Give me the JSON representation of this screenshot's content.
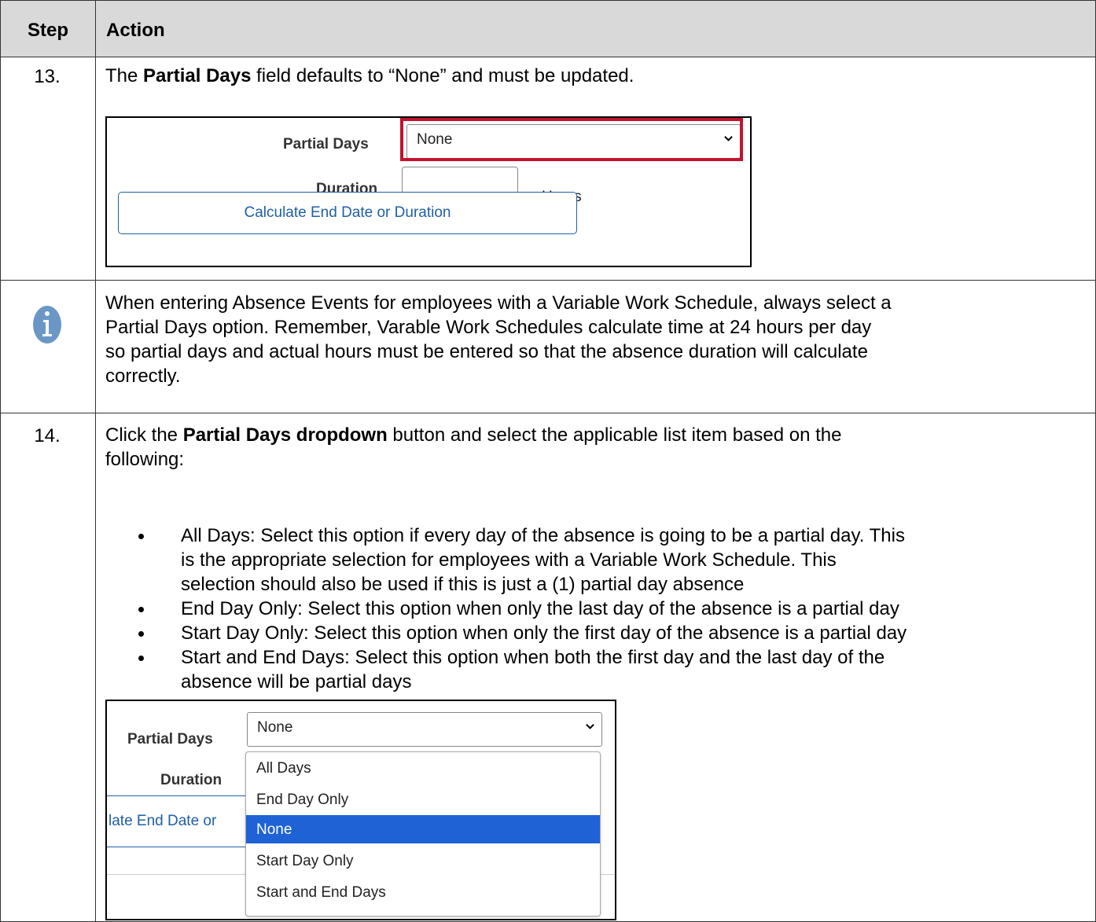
{
  "header": {
    "step": "Step",
    "action": "Action"
  },
  "row13": {
    "step": "13.",
    "text_pre": "The ",
    "text_bold": "Partial Days",
    "text_post": " field defaults to “None” and must be updated.",
    "screenshot": {
      "partial_days_label": "Partial Days",
      "partial_days_value": "None",
      "duration_label": "Duration",
      "duration_value": "",
      "hours_label": "Hours",
      "calc_button": "Calculate End Date or Duration",
      "highlight_color": "#c4122f"
    }
  },
  "info_row": {
    "icon": "info-icon",
    "lines": [
      "When entering Absence Events for employees with a Variable Work Schedule, always select a",
      "Partial Days option.  Remember, Varable Work Schedules calculate time at 24 hours per day",
      "so partial days and actual hours must be entered so that the absence duration will calculate",
      "correctly."
    ]
  },
  "row14": {
    "step": "14.",
    "line1_pre": "Click the ",
    "line1_bold": "Partial Days dropdown",
    "line1_post": " button and select the applicable list item based on the",
    "line2": "following:",
    "bullets": [
      [
        "All Days: Select this option if every day of the absence is going to be a partial day.  This",
        "is the appropriate selection for employees with a Variable Work Schedule.  This",
        "selection should also be used if this is just a (1) partial day absence"
      ],
      [
        "End Day Only: Select this option when only the last day of the absence is a partial day"
      ],
      [
        "Start Day Only: Select this option when only the first day of the absence is a partial day"
      ],
      [
        "Start and End Days: Select this option when both the first day and the last day of the",
        "absence will be partial days"
      ]
    ],
    "screenshot": {
      "partial_days_label": "Partial Days",
      "partial_days_value": "None",
      "duration_label": "Duration",
      "calc_button_partial": "late End Date or",
      "options": [
        "All Days",
        "End Day Only",
        "None",
        "Start Day Only",
        "Start and End Days"
      ],
      "selected_option": "None",
      "selected_color": "#1e62d6"
    }
  }
}
